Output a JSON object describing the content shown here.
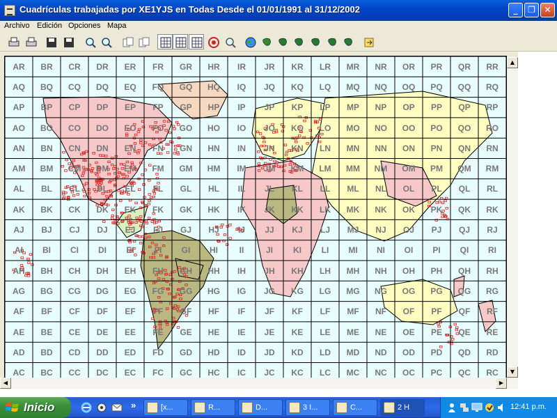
{
  "window": {
    "title": "Cuadrículas trabajadas por XE1YJS en Todas Desde el 01/01/1991 al 31/12/2002",
    "minimize": "_",
    "maximize": "❐",
    "close": "✕"
  },
  "menu": [
    "Archivo",
    "Edición",
    "Opciones",
    "Mapa"
  ],
  "toolbar_icons": [
    "print-icon",
    "print-preview-icon",
    "save-icon",
    "save-as-icon",
    "zoom-window-icon",
    "zoom-extents-icon",
    "copy-icon",
    "paste-icon",
    "grid-select-icon",
    "grid-icon",
    "grid-32-icon",
    "target-icon",
    "find-icon",
    "globe-icon",
    "continent-africa-asia-icon",
    "continent-south-america-icon",
    "continent-north-america-icon",
    "continent-europe-icon",
    "continent-africa-icon",
    "continent-oceania-icon",
    "export-icon"
  ],
  "grid": {
    "columns": [
      "A",
      "B",
      "C",
      "D",
      "E",
      "F",
      "G",
      "H",
      "I",
      "J",
      "K",
      "L",
      "M",
      "N",
      "O",
      "P",
      "Q",
      "R"
    ],
    "rows": [
      "R",
      "Q",
      "P",
      "O",
      "N",
      "M",
      "L",
      "K",
      "J",
      "I",
      "H",
      "G",
      "F",
      "E",
      "D",
      "C"
    ],
    "line_color": "#000000",
    "label_color": "#777777"
  },
  "map": {
    "ocean_color": "#e8fdfd",
    "worked_square_color": "#dd2020",
    "land_colors": [
      "#f6c8c8",
      "#fefec0",
      "#b8b880",
      "#f7d8c0",
      "#d8f0c0"
    ]
  },
  "scrollbars": {
    "up": "▲",
    "down": "▼",
    "left": "◀",
    "right": "▶"
  },
  "taskbar": {
    "start_label": "Inicio",
    "overflow": "»",
    "tasks": [
      {
        "label": "[x...",
        "icon": "mail-icon"
      },
      {
        "label": "R...",
        "icon": "folder-icon"
      },
      {
        "label": "D...",
        "icon": "globe-icon"
      },
      {
        "label": "3 I...",
        "icon": "ie-icon"
      },
      {
        "label": "C...",
        "icon": "app-icon"
      },
      {
        "label": "2 H",
        "icon": "hamradio-icon"
      }
    ],
    "clock": "12:41 p.m.",
    "tray_chevron": "«"
  }
}
